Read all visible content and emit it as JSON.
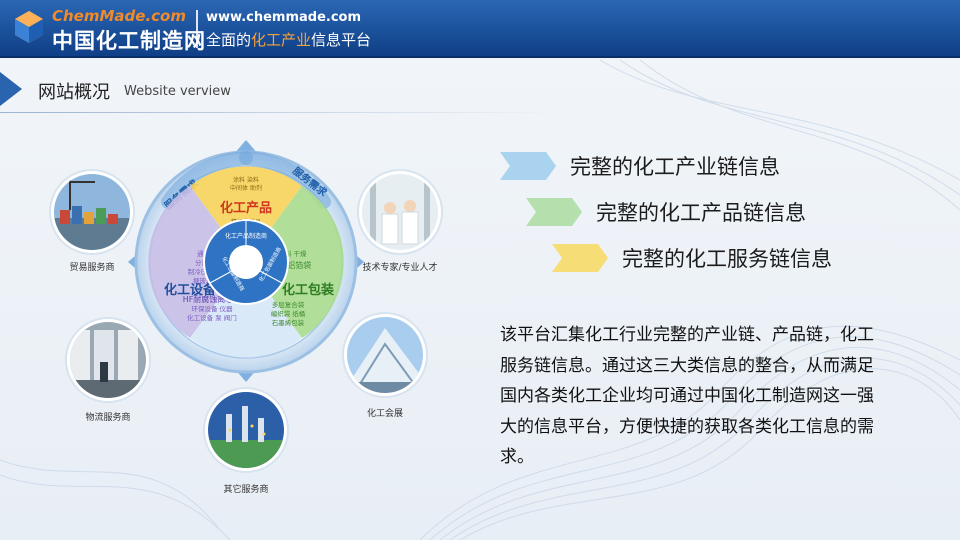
{
  "header": {
    "logo_en": "ChemMade.com",
    "logo_cn": "中国化工制造网",
    "url": "www.chemmade.com",
    "slogan_pre": "全面的",
    "slogan_highlight": "化工产业",
    "slogan_post": "信息平台"
  },
  "section": {
    "title": "网站概况",
    "subtitle": "Website verview"
  },
  "diagram": {
    "center_label": "化工产品制造商",
    "ring_left": "化工设备制造商",
    "ring_right": "化工包装制造商",
    "seg_top": "化工产品",
    "seg_left": "化工设备",
    "seg_right": "化工包装",
    "arc_left": "服务需求",
    "arc_right": "服务需求",
    "left_words": [
      "通用设备",
      "分离设备",
      "制冷压缩机",
      "搪玻璃机",
      "离心机",
      "HF耐腐蚀离心泵",
      "环保设备 仪器",
      "化工设备 泵 阀门"
    ],
    "right_words": [
      "包装材料 干燥",
      "塑料桶 铝箔袋",
      "多层复合袋",
      "编织袋 纸桶",
      "石墨烯包装"
    ],
    "top_words": [
      "涂料 染料",
      "中间体 助剂",
      "精细化学品"
    ],
    "satellites": [
      {
        "caption": "贸易服务商",
        "icon": "port-photo-icon"
      },
      {
        "caption": "技术专家/专业人才",
        "icon": "lab-photo-icon"
      },
      {
        "caption": "物流服务商",
        "icon": "warehouse-photo-icon"
      },
      {
        "caption": "化工会展",
        "icon": "exhibition-photo-icon"
      },
      {
        "caption": "其它服务商",
        "icon": "plant-photo-icon"
      }
    ]
  },
  "features": [
    {
      "text": "完整的化工产业链信息",
      "color": "#a9d3ee"
    },
    {
      "text": "完整的化工产品链信息",
      "color": "#b5e0ae"
    },
    {
      "text": "完整的化工服务链信息",
      "color": "#f6dd76"
    }
  ],
  "description": "该平台汇集化工行业完整的产业链、产品链，化工服务链信息。通过这三大类信息的整合，从而满足国内各类化工企业均可通过中国化工制造网这一强大的信息平台，方便快捷的获取各类化工信息的需求。",
  "colors": {
    "header": "#1a4f9c",
    "accent_orange": "#f08a2a",
    "title_triangle": "#2a63ae",
    "ring_blue": "#8ab4dc",
    "seg_yellow": "#f6d35a",
    "seg_purple": "#c7bde6",
    "seg_green": "#a9dc8e"
  }
}
